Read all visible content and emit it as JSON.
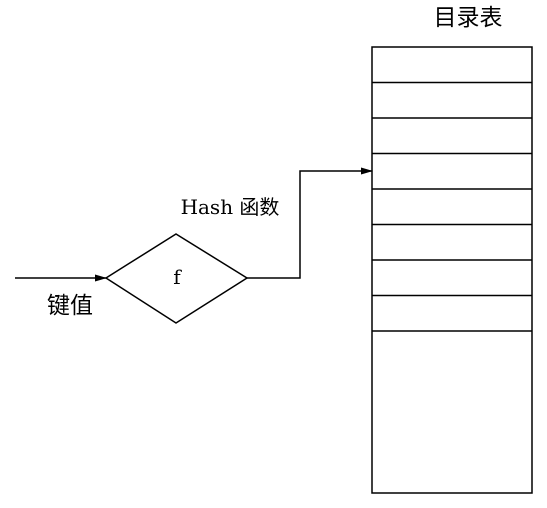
{
  "diagram": {
    "title": "目录表",
    "function_label": "Hash 函数",
    "node_label": "f",
    "input_label": "键值",
    "directory_slots": 8
  }
}
